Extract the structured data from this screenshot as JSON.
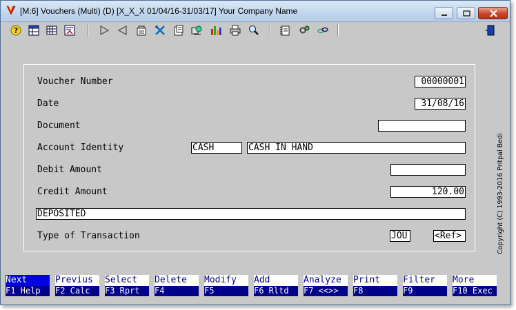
{
  "window": {
    "title": "[M:6]  Vouchers (Multi) (D)  [X_X_X  01/04/16-31/03/17]  Your Company Name"
  },
  "toolbar": {
    "icons": [
      "help-icon",
      "grid-icon",
      "table-icon",
      "report-icon",
      "play-forward-icon",
      "play-back-icon",
      "options-icon",
      "tools-icon",
      "document-icon",
      "process-icon",
      "bar-chart-icon",
      "print-icon",
      "zoom-icon",
      "notes-icon",
      "settings-icon",
      "link-icon",
      "exit-icon"
    ]
  },
  "form": {
    "voucher_number_label": "Voucher Number",
    "voucher_number_value": "00000001",
    "date_label": "Date",
    "date_value": "31/08/16",
    "document_label": "Document",
    "document_value": "",
    "account_identity_label": "Account Identity",
    "account_code": "CASH",
    "account_name": "CASH IN HAND",
    "debit_label": "Debit Amount",
    "debit_value": "",
    "credit_label": "Credit Amount",
    "credit_value": "120.00",
    "narration_value": "DEPOSITED",
    "transaction_type_label": "Type of Transaction",
    "transaction_type_value": "JOU",
    "ref_value": "<Ref>"
  },
  "copyright": "Copyright (C) 1993-2016 Pritpal Bedi",
  "function_keys": [
    {
      "action": "Next",
      "key": "F1 Help"
    },
    {
      "action": "Previus",
      "key": "F2 Calc"
    },
    {
      "action": "Select",
      "key": "F3 Rprt"
    },
    {
      "action": "Delete",
      "key": "F4"
    },
    {
      "action": "Modify",
      "key": "F5"
    },
    {
      "action": "Add",
      "key": "F6 Rltd"
    },
    {
      "action": "Analyze",
      "key": "F7 <<>>"
    },
    {
      "action": "Print",
      "key": "F8"
    },
    {
      "action": "Filter",
      "key": "F9"
    },
    {
      "action": "More",
      "key": "F10 Exec"
    }
  ],
  "colors": {
    "background": "#c8c8c8",
    "fkey_bar": "#00008b",
    "fkey_text": "#00008b",
    "active_fkey": "#0000e0"
  }
}
